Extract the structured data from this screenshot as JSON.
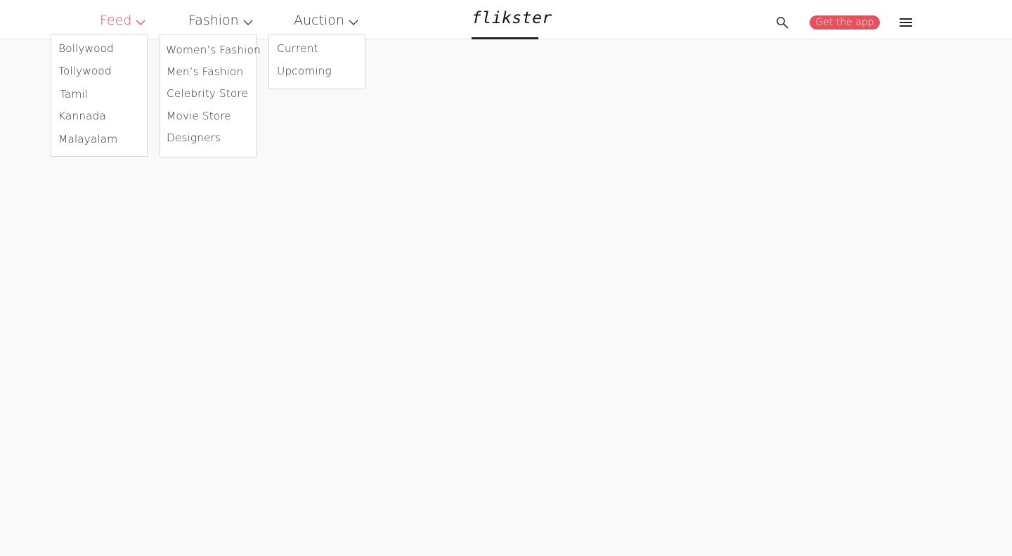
{
  "nav": {
    "feed": {
      "label": "Feed",
      "active": true
    },
    "fashion": {
      "label": "Fashion"
    },
    "auction": {
      "label": "Auction"
    }
  },
  "logo": {
    "text": "flikster"
  },
  "header": {
    "search_icon": "search-icon",
    "app_button_label": "Get the app",
    "menu_icon": "hamburger-menu-icon"
  },
  "dropdowns": {
    "feed": [
      "Bollywood",
      "Tollywood",
      "Tamil",
      "Kannada",
      "Malayalam"
    ],
    "fashion": [
      "Women’s Fashion",
      "Men’s Fashion",
      "Celebrity Store",
      "Movie Store",
      "Designers"
    ],
    "auction": [
      "Current",
      "Upcoming"
    ]
  },
  "colors": {
    "accent": "#e8505b",
    "background": "#f9f9f9",
    "header_bg": "#ffffff"
  }
}
